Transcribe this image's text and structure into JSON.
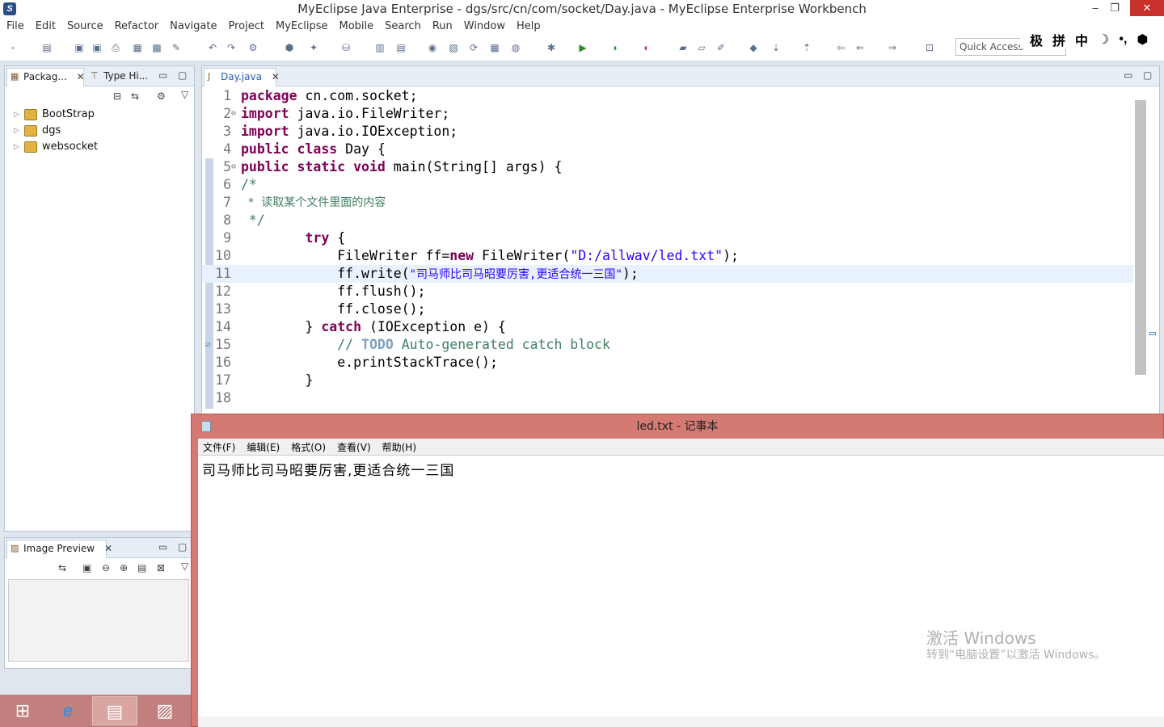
{
  "window": {
    "title": "MyEclipse Java Enterprise - dgs/src/cn/com/socket/Day.java - MyEclipse Enterprise Workbench",
    "min": "–",
    "max": "❐",
    "close": "✕"
  },
  "menu": [
    "File",
    "Edit",
    "Source",
    "Refactor",
    "Navigate",
    "Project",
    "MyEclipse",
    "Mobile",
    "Search",
    "Run",
    "Window",
    "Help"
  ],
  "toolbar": {
    "quick_access": "Quick Access",
    "ime": [
      "极",
      "拼",
      "中",
      "☽",
      "•,",
      "⬢"
    ]
  },
  "package_explorer": {
    "tabs": [
      {
        "label": "Packag...",
        "close": "✕"
      },
      {
        "label": "Type Hi...",
        "close": ""
      }
    ],
    "projects": [
      "BootStrap",
      "dgs",
      "websocket"
    ]
  },
  "image_preview": {
    "tab": "Image Preview",
    "close": "✕"
  },
  "editor": {
    "tab": "Day.java",
    "close": "✕",
    "lines": [
      {
        "n": "1",
        "text": "package cn.com.socket;"
      },
      {
        "n": "2",
        "text": "import java.io.FileWriter;"
      },
      {
        "n": "3",
        "text": "import java.io.IOException;"
      },
      {
        "n": "4",
        "text": "public class Day {"
      },
      {
        "n": "5",
        "text": "public static void main(String[] args) {"
      },
      {
        "n": "6",
        "text": "/*"
      },
      {
        "n": "7",
        "text": " * 读取某个文件里面的内容"
      },
      {
        "n": "8",
        "text": " */"
      },
      {
        "n": "9",
        "text": "        try {"
      },
      {
        "n": "10",
        "text": "            FileWriter ff=new FileWriter(\"D:/allwav/led.txt\");"
      },
      {
        "n": "11",
        "text": "            ff.write(\"司马师比司马昭要厉害,更适合统一三国\");"
      },
      {
        "n": "12",
        "text": "            ff.flush();"
      },
      {
        "n": "13",
        "text": "            ff.close();"
      },
      {
        "n": "14",
        "text": "        } catch (IOException e) {"
      },
      {
        "n": "15",
        "text": "            // TODO Auto-generated catch block"
      },
      {
        "n": "16",
        "text": "            e.printStackTrace();"
      },
      {
        "n": "17",
        "text": "        }"
      },
      {
        "n": "18",
        "text": ""
      }
    ]
  },
  "notepad": {
    "title": "led.txt - 记事本",
    "menu": [
      "文件(F)",
      "编辑(E)",
      "格式(O)",
      "查看(V)",
      "帮助(H)"
    ],
    "content": "司马师比司马昭要厉害,更适合统一三国"
  },
  "watermark": {
    "line1": "激活 Windows",
    "line2": "转到“电脑设置”以激活 Windows。"
  }
}
